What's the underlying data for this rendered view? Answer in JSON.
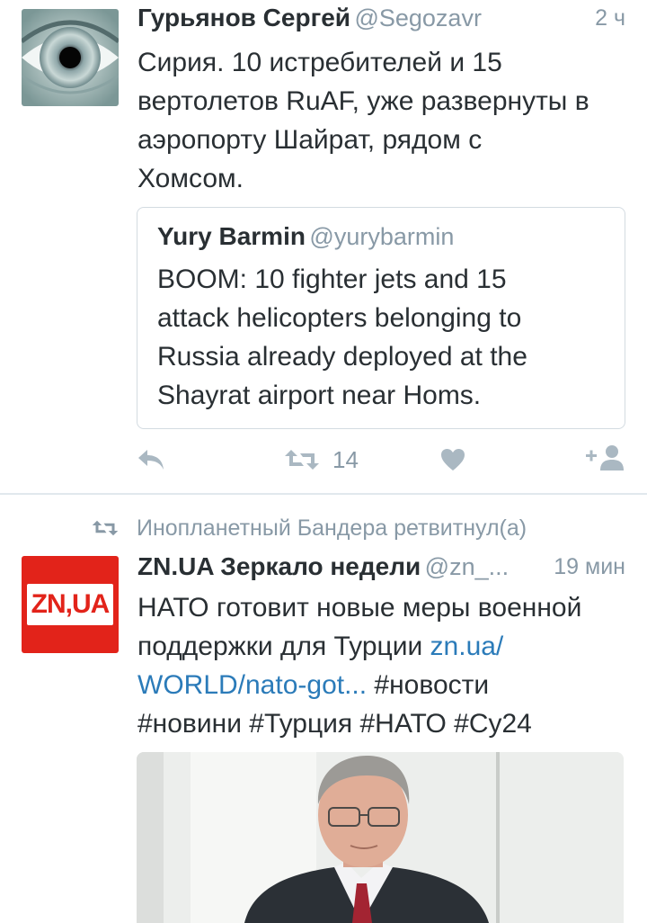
{
  "tweet1": {
    "author_name": "Гурьянов Сергей",
    "author_handle": "@Segozavr",
    "time": "2 ч",
    "text_lines": [
      "Сирия. 10 истребителей и 15",
      "вертолетов RuAF, уже развернуты в",
      "аэропорту Шайрат, рядом с",
      "Хомсом."
    ],
    "quote": {
      "author_name": "Yury Barmin",
      "author_handle": "@yurybarmin",
      "text_lines": [
        "BOOM: 10 fighter jets and 15",
        "attack helicopters belonging to",
        "Russia already deployed at the",
        "Shayrat airport near Homs."
      ]
    },
    "actions": {
      "reply_icon": "reply-icon",
      "retweet_icon": "retweet-icon",
      "retweet_count": "14",
      "like_icon": "heart-icon",
      "follow_icon": "follow-icon"
    }
  },
  "tweet2": {
    "retweeted_by": "Инопланетный Бандера ретвитнул(а)",
    "author_name": "ZN.UA Зеркало недели",
    "author_handle": "@zn_...",
    "time": "19 мин",
    "avatar_text": "ZN,UA",
    "text_line1": "НАТО готовит новые меры военной",
    "text_line2_plain": "поддержки для Турции ",
    "text_line2_link": "zn.ua/",
    "text_line3_link": "WORLD/nato-got...",
    "text_line3_plain": " #новости",
    "text_line4": "#новини #Турция #НАТО #Су24"
  },
  "colors": {
    "text": "#292f33",
    "secondary": "#8899a6",
    "link": "#2b7bb9",
    "icon": "#aab8c2",
    "zn_red": "#e2231a"
  }
}
